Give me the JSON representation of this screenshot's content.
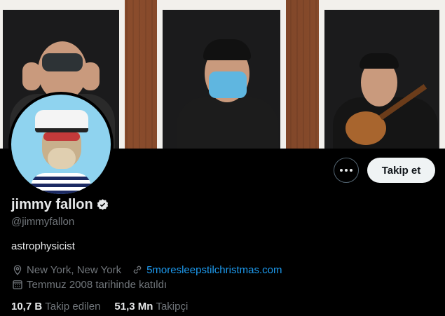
{
  "profile": {
    "name": "jimmy fallon",
    "handle": "@jimmyfallon",
    "bio": "astrophysicist",
    "location": "New York, New York",
    "website": "5moresleepstilchristmas.com",
    "joined": "Temmuz 2008 tarihinde katıldı",
    "verified": true
  },
  "actions": {
    "follow_label": "Takip et",
    "more_icon": "more-dots-icon"
  },
  "stats": {
    "following_count": "10,7 B",
    "following_label": "Takip edilen",
    "followers_count": "51,3 Mn",
    "followers_label": "Takipçi"
  },
  "colors": {
    "link": "#1d9bf0",
    "verified_badge": "#e7e9ea",
    "secondary_text": "#71767b"
  }
}
